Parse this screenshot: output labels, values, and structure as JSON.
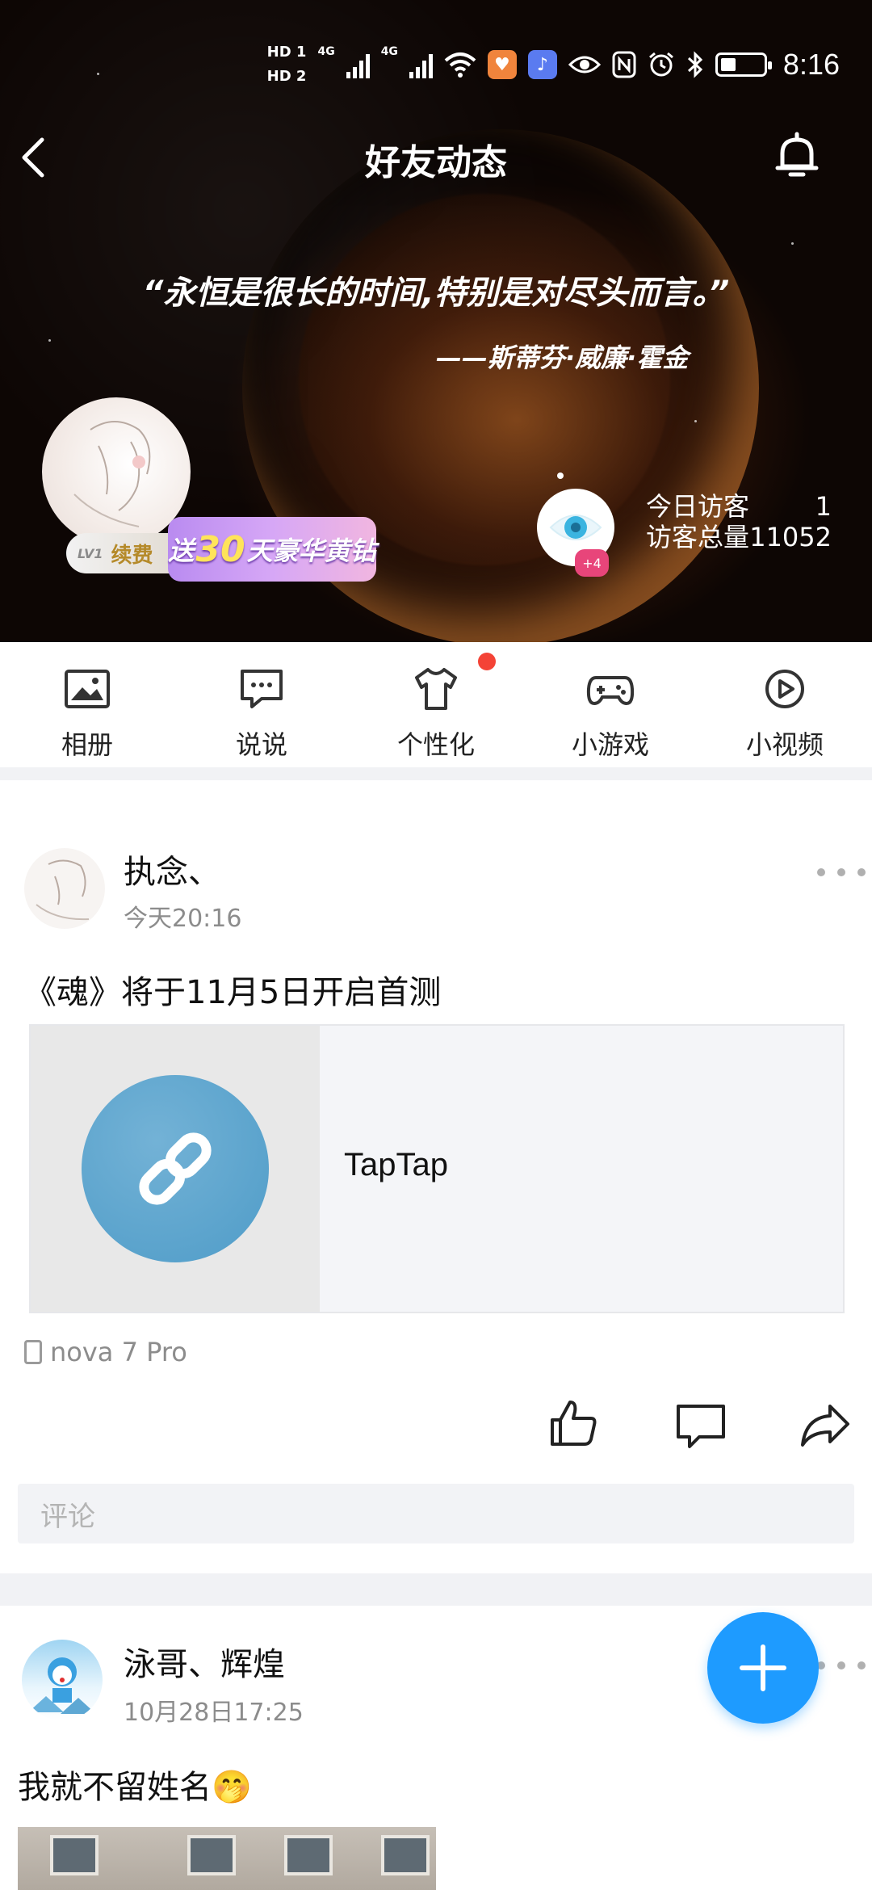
{
  "status_bar": {
    "hd1": "HD 1",
    "hd2": "HD 2",
    "net1": "4G",
    "net2": "4G",
    "time": "8:16"
  },
  "header": {
    "title": "好友动态",
    "quote": "“永恒是很长的时间,特别是对尽头而言。”",
    "quote_author": "——斯蒂芬·威廉·霍金"
  },
  "profile": {
    "vip_level": "LV1",
    "vip_renew": "续费",
    "promo_prefix": "送",
    "promo_number": "30",
    "promo_suffix": "天豪华黄钻",
    "visitor_badge": "+4",
    "today_visitors_label": "今日访客",
    "today_visitors_value": "1",
    "total_visitors_label": "访客总量",
    "total_visitors_value": "11052"
  },
  "shortcuts": [
    {
      "label": "相册",
      "icon": "photo-album-icon"
    },
    {
      "label": "说说",
      "icon": "chat-bubble-icon"
    },
    {
      "label": "个性化",
      "icon": "tshirt-icon"
    },
    {
      "label": "小游戏",
      "icon": "gamepad-icon"
    },
    {
      "label": "小视频",
      "icon": "play-circle-icon"
    }
  ],
  "posts": [
    {
      "author": "执念、",
      "time": "今天20:16",
      "text": "《魂》将于11月5日开启首测",
      "link_title": "TapTap",
      "device": "nova 7 Pro",
      "comment_placeholder": "评论"
    },
    {
      "author": "泳哥、辉煌",
      "time": "10月28日17:25",
      "text": "我就不留姓名🤭"
    }
  ],
  "colors": {
    "accent": "#1e9bff",
    "notification_dot": "#f44336",
    "secondary_text": "#8c8c8c"
  }
}
